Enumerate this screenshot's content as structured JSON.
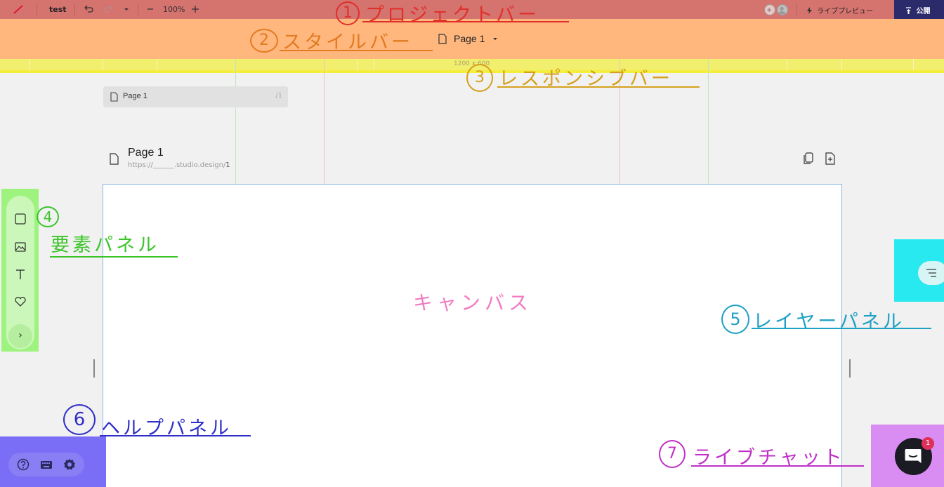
{
  "project_bar": {
    "project_name": "test",
    "zoom": "100%",
    "live_preview_label": "ライブプレビュー",
    "publish_label": "公開",
    "icons": [
      "logo-slash-icon",
      "undo-icon",
      "redo-icon",
      "dropdown-caret-icon",
      "zoom-out-icon",
      "zoom-in-icon",
      "add-collaborator-icon",
      "user-avatar-icon",
      "lightning-icon",
      "upload-icon"
    ]
  },
  "style_bar": {
    "page_label": "Page 1",
    "icons": [
      "page-icon",
      "dropdown-caret-icon"
    ]
  },
  "responsive_bar": {
    "size_label": "1200 x 600"
  },
  "canvas": {
    "page_tab_label": "Page 1",
    "page_tab_count": "/1",
    "page_title": "Page 1",
    "page_url_prefix": "https://______.studio.design/",
    "page_url_suffix": "1",
    "icons": [
      "page-icon",
      "duplicate-page-icon",
      "add-page-icon"
    ]
  },
  "element_panel": {
    "icons": [
      "box-icon",
      "image-icon",
      "text-icon",
      "heart-icon",
      "chevron-right-icon"
    ],
    "more_label": "›"
  },
  "layer_panel": {
    "icons": [
      "layers-icon"
    ]
  },
  "help_panel": {
    "icons": [
      "help-icon",
      "keyboard-icon",
      "settings-icon"
    ]
  },
  "live_chat": {
    "badge_count": "1",
    "icons": [
      "chat-icon"
    ]
  },
  "annotations": {
    "project_bar": {
      "num": "1",
      "label": "プロジェクトバー",
      "color": "#e0302a"
    },
    "style_bar": {
      "num": "2",
      "label": "スタイルバー",
      "color": "#e27a22"
    },
    "responsive_bar": {
      "num": "3",
      "label": "レスポンシブバー",
      "color": "#d4a01f"
    },
    "element_panel": {
      "num": "4",
      "label": "要素パネル",
      "color": "#3cc42a"
    },
    "layer_panel": {
      "num": "5",
      "label": "レイヤーパネル",
      "color": "#1ea1c4"
    },
    "help_panel": {
      "num": "6",
      "label": "ヘルプパネル",
      "color": "#2f2fc8"
    },
    "live_chat": {
      "num": "7",
      "label": "ライブチャット",
      "color": "#c030c8"
    },
    "canvas_label": {
      "label": "キャンバス",
      "color": "#f07cc2"
    }
  }
}
